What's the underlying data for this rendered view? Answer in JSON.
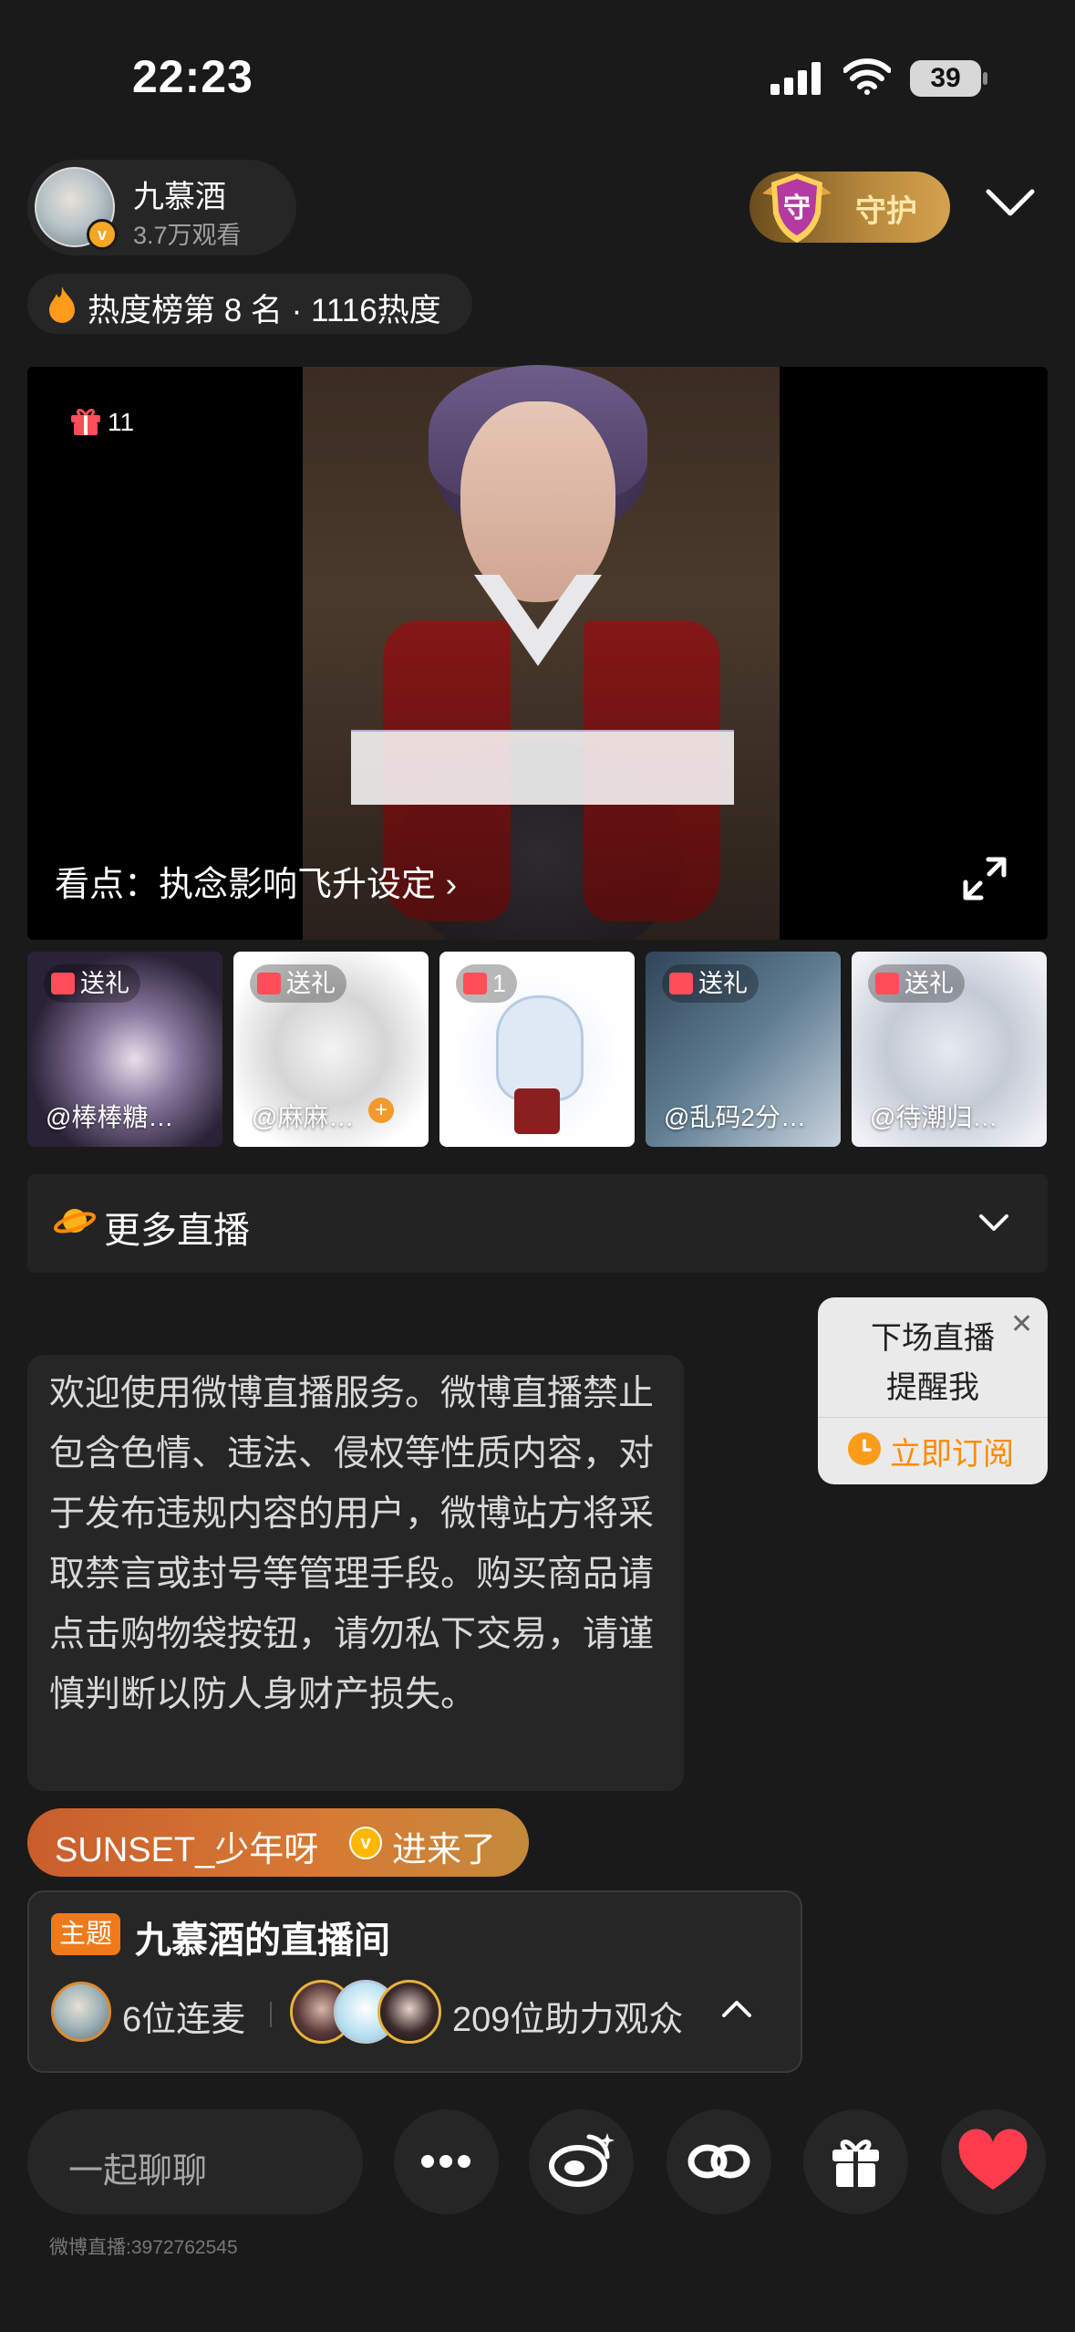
{
  "status_bar": {
    "time": "22:23",
    "battery": "39"
  },
  "streamer": {
    "name": "九慕酒",
    "viewers": "3.7万观看",
    "verified_mark": "v"
  },
  "guard": {
    "label": "守护",
    "shield_char": "守"
  },
  "heat": {
    "text": "热度榜第 8 名 · 1116热度"
  },
  "video": {
    "gift_count": "11",
    "highlight": "看点：执念影响飞升设定 ›"
  },
  "thumbnails": [
    {
      "tag": "送礼",
      "name": "@棒棒糖…"
    },
    {
      "tag": "送礼",
      "name": "@麻麻…"
    },
    {
      "tag": "1",
      "name": ""
    },
    {
      "tag": "送礼",
      "name": "@乱码2分…"
    },
    {
      "tag": "送礼",
      "name": "@待潮归…"
    }
  ],
  "more_live": {
    "label": "更多直播"
  },
  "reminder": {
    "line1": "下场直播",
    "line2": "提醒我",
    "action": "立即订阅",
    "close": "✕"
  },
  "notice": {
    "text": "欢迎使用微博直播服务。微博直播禁止包含色情、违法、侵权等性质内容，对于发布违规内容的用户，微博站方将采取禁言或封号等管理手段。购买商品请点击购物袋按钮，请勿私下交易，请谨慎判断以防人身财产损失。"
  },
  "entered": {
    "user": "SUNSET_少年呀",
    "action": "进来了",
    "badge": "v"
  },
  "topic": {
    "tag": "主题",
    "title": "九慕酒的直播间",
    "cohost": "6位连麦",
    "supporters": "209位助力观众"
  },
  "bottom_bar": {
    "chat_placeholder": "一起聊聊",
    "room_id": "微博直播:3972762545"
  },
  "colors": {
    "accent_orange": "#f07a1a",
    "like_red": "#ff3b4e",
    "gold": "#d4a24f"
  }
}
